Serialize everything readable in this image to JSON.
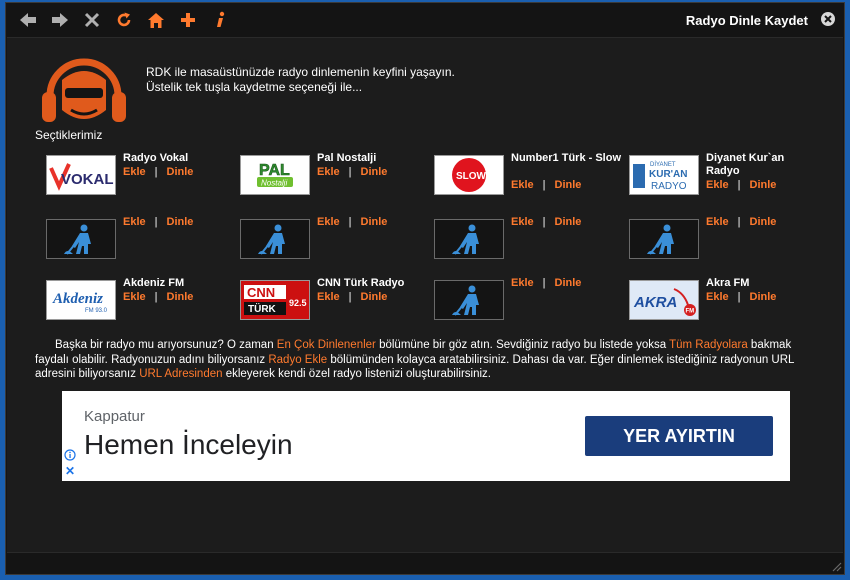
{
  "window": {
    "title": "Radyo Dinle Kaydet"
  },
  "intro": {
    "line1": "RDK  ile masaüstünüzde radyo dinlemenin keyfini yaşayın.",
    "line2": "Üstelik tek tuşla kaydetme seçeneği ile..."
  },
  "favorites": {
    "title": "Seçtiklerimiz",
    "add_label": "Ekle",
    "listen_label": "Dinle",
    "separator": "|",
    "stations": [
      {
        "name": "Radyo Vokal",
        "logo": "radyo-vokal-logo"
      },
      {
        "name": "Pal Nostalji",
        "logo": "pal-nostalji-logo"
      },
      {
        "name": "Number1 Türk - Slow",
        "logo": "slow-logo"
      },
      {
        "name": "Diyanet Kur`an Radyo",
        "logo": "diyanet-kuran-radyo-logo"
      },
      {
        "name": "",
        "logo": "under-construction-icon"
      },
      {
        "name": "",
        "logo": "under-construction-icon"
      },
      {
        "name": "",
        "logo": "under-construction-icon"
      },
      {
        "name": "",
        "logo": "under-construction-icon"
      },
      {
        "name": "Akdeniz FM",
        "logo": "akdeniz-fm-logo"
      },
      {
        "name": "CNN Türk Radyo",
        "logo": "cnn-turk-logo"
      },
      {
        "name": "",
        "logo": "under-construction-icon"
      },
      {
        "name": "Akra FM",
        "logo": "akra-fm-logo"
      }
    ]
  },
  "logos": {
    "vokal": "VOKAL",
    "pal": "PAL",
    "pal_sub": "Nostalji",
    "slow": "SLOW",
    "diyanet_top": "DİYANET",
    "diyanet_mid": "KUR'AN",
    "diyanet_bot": "RADYO",
    "akdeniz": "Akdeniz",
    "akdeniz_sub": "FM 93.0",
    "cnn": "CNN",
    "turk": "TÜRK",
    "cnn_freq": "92.5",
    "akra": "AKRA",
    "akra_fm": "FM"
  },
  "info": {
    "t1": "Başka bir radyo mu arıyorsunuz? O zaman ",
    "l1": "En Çok Dinlenenler",
    "t2": " bölümüne bir göz atın. Sevdiğiniz radyo bu listede yoksa ",
    "l2": "Tüm Radyolara",
    "t3": " bakmak faydalı olabilir. Radyonuzun adını biliyorsanız ",
    "l3": "Radyo Ekle",
    "t4": " bölümünden kolayca aratabilirsiniz. Dahası da var. Eğer dinlemek istediğiniz radyonun URL adresini biliyorsanız ",
    "l4": "URL Adresinden",
    "t5": " ekleyerek kendi özel radyo listenizi oluşturabilirsiniz."
  },
  "ad": {
    "brand": "Kappatur",
    "headline": "Hemen İnceleyin",
    "cta": "YER AYIRTIN",
    "close": "✕"
  },
  "colors": {
    "accent": "#ff7a2e",
    "background": "#1c1c1c",
    "toolbar_icon": "#b0b0b0",
    "ad_button": "#1a3d7c"
  }
}
